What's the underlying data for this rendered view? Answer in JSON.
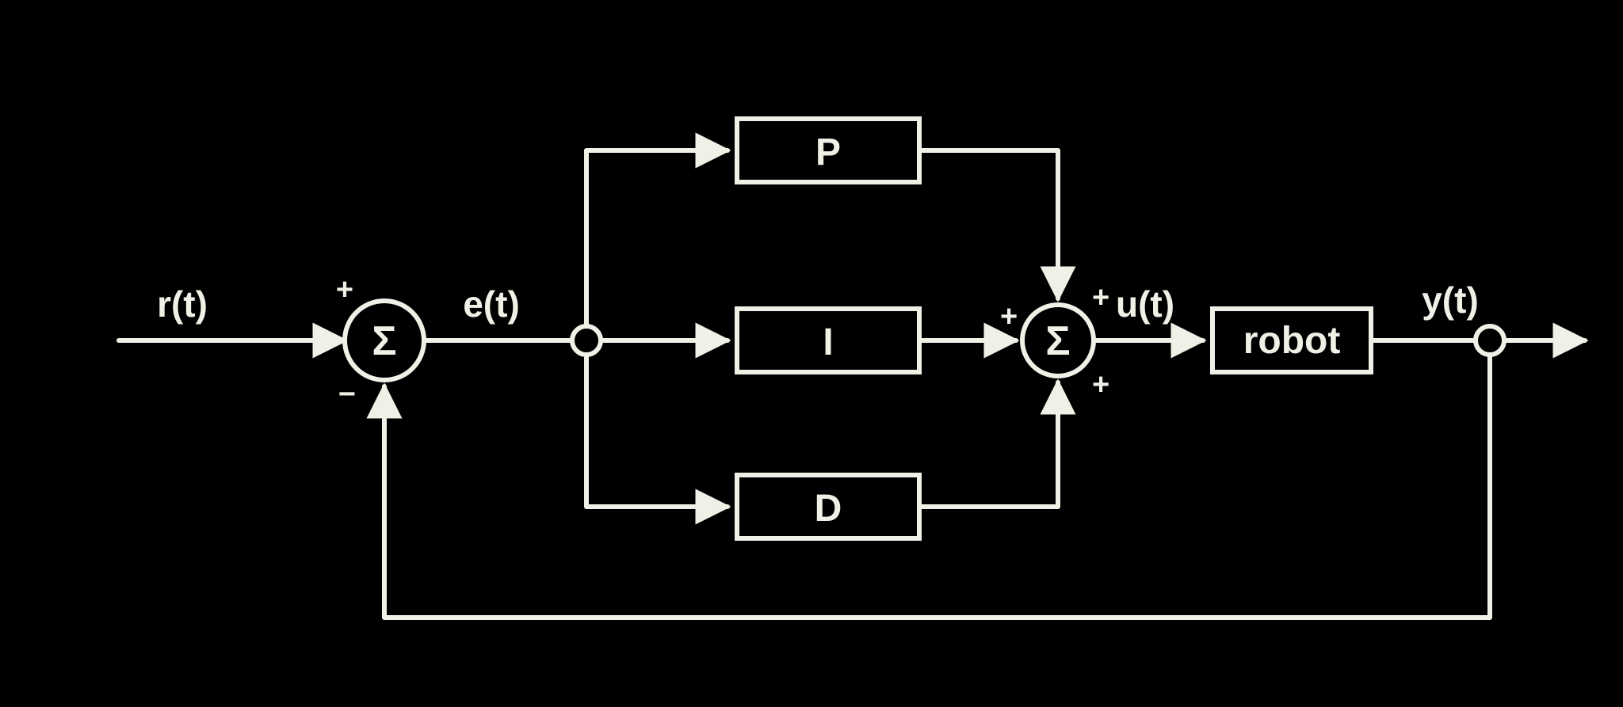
{
  "diagram": {
    "type": "block-diagram",
    "description": "PID controller closed-loop block diagram",
    "signals": {
      "reference": "r(t)",
      "error": "e(t)",
      "control": "u(t)",
      "output": "y(t)"
    },
    "summing_junctions": {
      "error_sum": {
        "symbol": "Σ",
        "signs": {
          "reference": "+",
          "feedback": "−"
        }
      },
      "pid_sum": {
        "symbol": "Σ",
        "signs": {
          "p": "+",
          "i": "+",
          "d": "+"
        }
      }
    },
    "blocks": {
      "proportional": "P",
      "integral": "I",
      "derivative": "D",
      "plant": "robot"
    },
    "colors": {
      "background": "#000000",
      "stroke": "#f1f0e6"
    }
  }
}
